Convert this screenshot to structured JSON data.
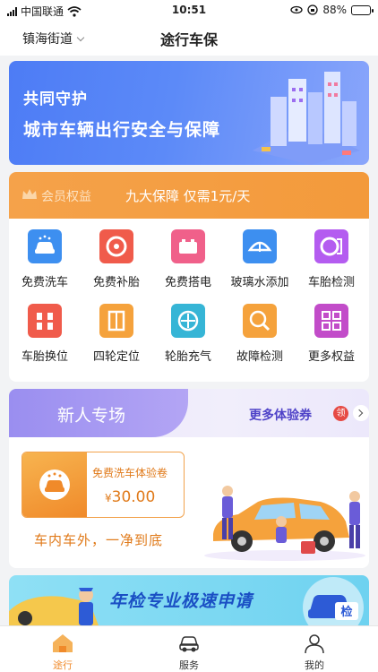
{
  "status_bar": {
    "carrier": "中国联通",
    "time": "10:51",
    "battery": "88%",
    "battery_level": 0.88
  },
  "header": {
    "location": "镇海街道",
    "title": "途行车保"
  },
  "banner": {
    "line1": "共同守护",
    "line2": "城市车辆出行安全与保障"
  },
  "member": {
    "title": "会员权益",
    "subtitle": "九大保障 仅需1元/天",
    "items": [
      {
        "label": "免费洗车",
        "icon": "car-wash-icon",
        "color": "#3d8ff0"
      },
      {
        "label": "免费补胎",
        "icon": "tire-repair-icon",
        "color": "#f05b4b"
      },
      {
        "label": "免费搭电",
        "icon": "battery-jump-icon",
        "color": "#f0608a"
      },
      {
        "label": "玻璃水添加",
        "icon": "windshield-fluid-icon",
        "color": "#3d8ff0"
      },
      {
        "label": "车胎检测",
        "icon": "tire-check-icon",
        "color": "#b45cf0"
      },
      {
        "label": "车胎换位",
        "icon": "tire-rotation-icon",
        "color": "#f05b4b"
      },
      {
        "label": "四轮定位",
        "icon": "wheel-alignment-icon",
        "color": "#f5a23c"
      },
      {
        "label": "轮胎充气",
        "icon": "tire-inflate-icon",
        "color": "#36b5d6"
      },
      {
        "label": "故障检测",
        "icon": "fault-check-icon",
        "color": "#f5a23c"
      },
      {
        "label": "更多权益",
        "icon": "more-benefits-icon",
        "color": "#c24cc9"
      }
    ]
  },
  "newbie": {
    "title": "新人专场",
    "more_label": "更多体验券",
    "badge": "领",
    "coupon": {
      "name": "免费洗车体验卷",
      "price": "30.00",
      "currency": "¥"
    },
    "slogan": "车内车外，一净到底"
  },
  "inspection": {
    "text": "年检专业极速申请",
    "badge": "检"
  },
  "tabbar": {
    "tabs": [
      {
        "label": "途行",
        "active": true
      },
      {
        "label": "服务",
        "active": false
      },
      {
        "label": "我的",
        "active": false
      }
    ],
    "active_color": "#f08a2a"
  }
}
